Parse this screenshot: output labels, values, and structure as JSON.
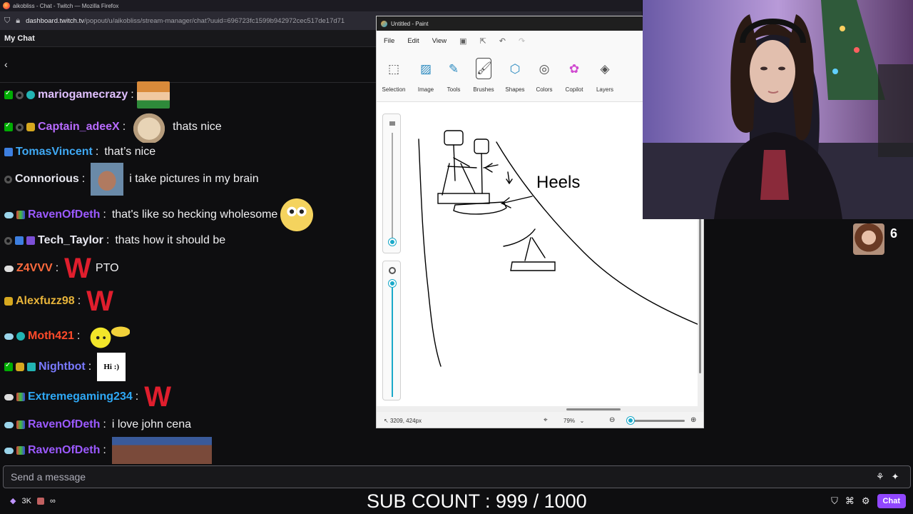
{
  "browser": {
    "window_title": "aikobliss - Chat - Twitch — Mozilla Firefox",
    "url_domain": "dashboard.twitch.tv",
    "url_path": "/popout/u/aikobliss/stream-manager/chat?uuid=696723fc1599b942972cec517de17d71"
  },
  "chat": {
    "header_title": "My Chat",
    "back_glyph": "‹",
    "messages": [
      {
        "user": "mariogamecrazy",
        "color": "#e0c0ff",
        "sep": ":",
        "text": ""
      },
      {
        "user": "Captain_adeeX",
        "color": "#b86bff",
        "sep": ":",
        "text": "thats nice"
      },
      {
        "user": "TomasVincent",
        "color": "#3fa9f5",
        "sep": ":",
        "text": "that’s nice"
      },
      {
        "user": "Connorious",
        "color": "#e8e8f0",
        "sep": ":",
        "text": "i take pictures in my brain"
      },
      {
        "user": "RavenOfDeth",
        "color": "#9b59ff",
        "sep": ":",
        "text": "that's like so hecking wholesome"
      },
      {
        "user": "Tech_Taylor",
        "color": "#e8e8f0",
        "sep": ":",
        "text": "thats how it should be"
      },
      {
        "user": "Z4VVV",
        "color": "#ff6a3d",
        "sep": ":",
        "text": "PTO"
      },
      {
        "user": "Alexfuzz98",
        "color": "#e8b43a",
        "sep": ":",
        "text": ""
      },
      {
        "user": "Moth421",
        "color": "#ff4a2a",
        "sep": ":",
        "text": ""
      },
      {
        "user": "Nightbot",
        "color": "#7a7aff",
        "sep": ":",
        "text": ""
      },
      {
        "user": "Extremegaming234",
        "color": "#2ea8f5",
        "sep": ":",
        "text": ""
      },
      {
        "user": "RavenOfDeth",
        "color": "#9b59ff",
        "sep": ":",
        "text": "i love john cena"
      },
      {
        "user": "RavenOfDeth",
        "color": "#9b59ff",
        "sep": ":",
        "text": ""
      }
    ],
    "w_emote": "W",
    "nightbot_emote": "Hi :)",
    "input_placeholder": "Send a message"
  },
  "bottom": {
    "viewers": "3K",
    "infinity": "∞",
    "sub_count": "SUB COUNT : 999 / 1000",
    "chat_button": "Chat"
  },
  "paint": {
    "title": "Untitled - Paint",
    "menu": [
      "File",
      "Edit",
      "View"
    ],
    "tools": [
      "Selection",
      "Image",
      "Tools",
      "Brushes",
      "Shapes",
      "Colors",
      "Copilot",
      "Layers"
    ],
    "drawing_text": "Heels",
    "coords": "3209, 424px",
    "zoom": "79%"
  },
  "stream": {
    "viewer_count": "6"
  },
  "colors": {
    "twitch_purple": "#9147ff",
    "paint_accent": "#1aa9c9"
  }
}
